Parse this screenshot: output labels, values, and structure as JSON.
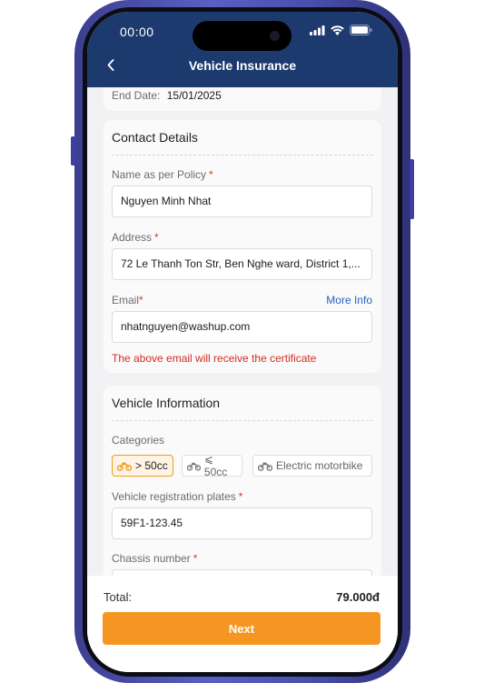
{
  "status_bar": {
    "time": "00:00"
  },
  "header": {
    "title": "Vehicle Insurance"
  },
  "policy_period": {
    "end_date_label": "End Date:",
    "end_date_value": "15/01/2025"
  },
  "contact_details": {
    "title": "Contact Details",
    "name": {
      "label": "Name as per Policy",
      "required_mark": "*",
      "value": "Nguyen Minh Nhat"
    },
    "address": {
      "label": "Address",
      "required_mark": "*",
      "value": "72 Le Thanh Ton Str, Ben Nghe ward, District 1,..."
    },
    "email": {
      "label": "Email",
      "required_mark": "*",
      "more_info_link": "More Info",
      "value": "nhatnguyen@washup.com",
      "note": "The above email will receive the certificate"
    }
  },
  "vehicle_information": {
    "title": "Vehicle Information",
    "categories_label": "Categories",
    "categories": [
      {
        "label": "> 50cc",
        "selected": true,
        "icon": "motorbike-icon"
      },
      {
        "label": "⩽ 50cc",
        "selected": false,
        "icon": "motorbike-icon"
      },
      {
        "label": "Electric motorbike",
        "selected": false,
        "icon": "electric-motorbike-icon"
      }
    ],
    "plates": {
      "label": "Vehicle registration plates",
      "required_mark": "*",
      "value": "59F1-123.45"
    },
    "chassis": {
      "label": "Chassis number",
      "required_mark": "*",
      "value": ""
    }
  },
  "footer": {
    "total_label": "Total:",
    "total_value": "79.000đ",
    "next_label": "Next"
  },
  "colors": {
    "header_bg": "#1d3a6f",
    "accent": "#f59622",
    "error": "#d32d22",
    "link": "#2a61c4"
  }
}
